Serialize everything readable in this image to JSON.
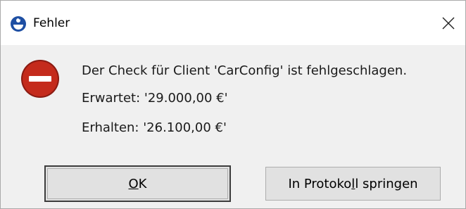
{
  "window": {
    "title": "Fehler",
    "app_icon": "blue-circle-logo-icon",
    "close_icon": "close-icon"
  },
  "dialog": {
    "icon": "error-stop-icon",
    "icon_color": "#c42b1c",
    "messages": [
      "Der Check für Client 'CarConfig' ist fehlgeschlagen.",
      "Erwartet: '29.000,00 €'",
      "Erhalten: '26.100,00 €'"
    ]
  },
  "buttons": {
    "ok": {
      "accel": "O",
      "rest": "K"
    },
    "log": {
      "before": "In Protoko",
      "accel": "l",
      "after": "l springen"
    }
  }
}
